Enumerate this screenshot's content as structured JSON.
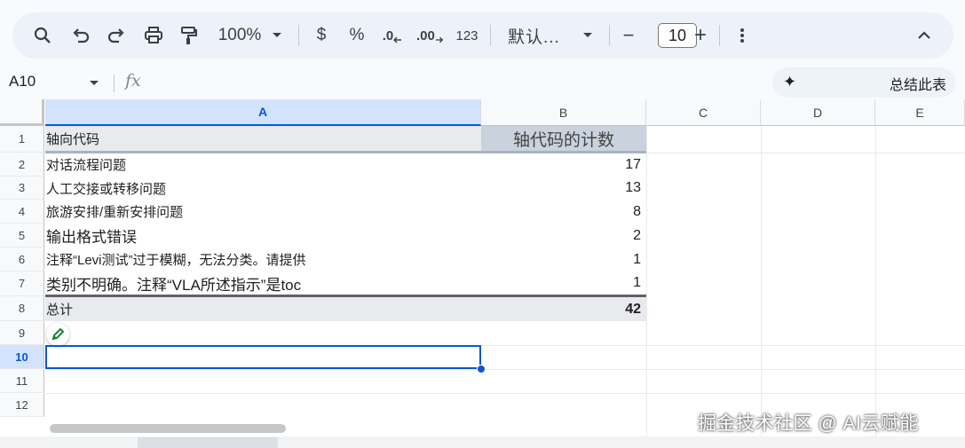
{
  "toolbar": {
    "zoom": "100%",
    "currency_label": "$",
    "percent_label": "%",
    "decrease_decimal_label": ".0",
    "increase_decimal_label": ".00",
    "number_format_label": "123",
    "font_name": "默认...",
    "font_size": "10",
    "minus_label": "−",
    "plus_label": "+"
  },
  "formula_bar": {
    "cell_ref": "A10",
    "fx_label": "fx",
    "summarize_label": "总结此表"
  },
  "columns": [
    "A",
    "B",
    "C",
    "D",
    "E"
  ],
  "rows": [
    "1",
    "2",
    "3",
    "4",
    "5",
    "6",
    "7",
    "8",
    "9",
    "10",
    "11",
    "12"
  ],
  "table": {
    "header": {
      "a": "轴向代码",
      "b": "轴代码的计数"
    },
    "rows": [
      {
        "a": "对话流程问题",
        "b": "17"
      },
      {
        "a": "人工交接或转移问题",
        "b": "13"
      },
      {
        "a": "旅游安排/重新安排问题",
        "b": "8"
      },
      {
        "a": "输出格式错误",
        "b": "2"
      },
      {
        "a": "注释“Levi测试”过于模糊，无法分类。请提供",
        "b": "1"
      },
      {
        "a": "类别不明确。注释“VLA所述指示”是toc",
        "b": "1"
      }
    ],
    "total": {
      "a": "总计",
      "b": "42"
    }
  },
  "watermark": "掘金技术社区 @ AI云赋能"
}
